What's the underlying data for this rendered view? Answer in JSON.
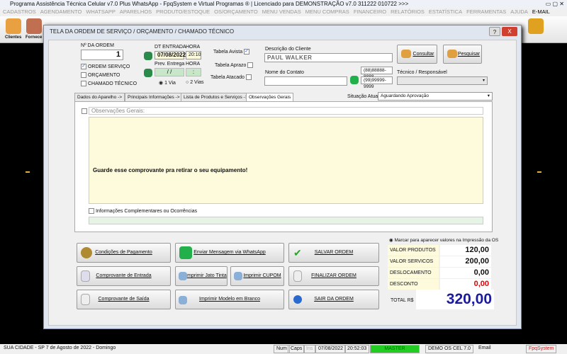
{
  "window": {
    "title": "Programa Assistência Técnica Celular v7.0 Plus WhatsApp - FpqSystem e Virtual Programas ® | Licenciado para  DEMONSTRAÇÃO v7.0 311222 010722 >>>"
  },
  "menu": [
    "CADASTROS",
    "AGENDAMENTO",
    "WHATSAPP",
    "APARELHOS",
    "PRODUTO/ESTOQUE",
    "OS/ORÇAMENTO",
    "MENU VENDAS",
    "MENU COMPRAS",
    "FINANCEIRO",
    "RELATÓRIOS",
    "ESTATÍSTICA",
    "FERRAMENTAS",
    "AJUDA",
    "E-MAIL"
  ],
  "toolbar": {
    "clientes": "Clientes",
    "fornece": "Fornece"
  },
  "dialog": {
    "title": "TELA DA ORDEM DE SERVIÇO / ORÇAMENTO / CHAMADO TÉCNICO",
    "help": "?",
    "close": "X"
  },
  "form": {
    "order_label": "Nº DA ORDEM",
    "order_value": "1",
    "types": [
      {
        "label": "ORDEM SERVIÇO",
        "checked": true
      },
      {
        "label": "ORÇAMENTO",
        "checked": false
      },
      {
        "label": "CHAMADO TÉCNICO",
        "checked": false
      }
    ],
    "dt_entrada_label": "DT ENTRADA",
    "hora_label": "HORA",
    "dt_entrada": "07/08/2022",
    "hora": "20:10",
    "prev_entrega_label": "Prev. Entrega",
    "hora2_label": "HORA",
    "prev_entrega": " / /",
    "hora2": ":",
    "via1": "1 Via",
    "via2": "2 Vias",
    "tables": [
      {
        "label": "Tabela Avista",
        "checked": true
      },
      {
        "label": "Tabela Aprazo",
        "checked": false
      },
      {
        "label": "Tabela Atacado",
        "checked": false
      }
    ],
    "cliente_label": "Descrição do Cliente",
    "cliente": "PAUL WALKER",
    "consultar": "Consultar",
    "pesquisar": "Pesquisar",
    "contato_label": "Nome do Contato",
    "contato": "",
    "phone1": "(88)88888-8888",
    "phone2": "(99)99999-9999",
    "tecnico_label": "Técnico / Responsável",
    "tecnico": ""
  },
  "tabs": [
    "Dados do Aparelho ->",
    "Principais Informações ->",
    "Lista de Produtos e Serviços ->",
    "Observações Gerais"
  ],
  "situacao_label": "Situação Atual:",
  "situacao": "Aguardando Aprovação",
  "obs": {
    "header": "Observações Gerais:",
    "text": "Guarde esse comprovante pra retirar o seu equipamento!",
    "complementares": "Informações Complementares ou Ocorrências"
  },
  "buttons": {
    "pagamento": "Condições de Pagamento",
    "whatsapp": "Enviar Mensagem via WhatsApp",
    "salvar": "SALVAR ORDEM",
    "entrada": "Comprovante de Entrada",
    "jato": "Imprimir Jato Tinta",
    "cupom": "Imprimir CUPOM",
    "finalizar": "FINALIZAR ORDEM",
    "saida": "Comprovante de Saída",
    "branco": "Imprimir Modelo em Branco",
    "sair": "SAIR DA ORDEM"
  },
  "values": {
    "marcar": "Marcar para aparecer valores na Impressão da OS",
    "rows": [
      {
        "label": "VALOR PRODUTOS",
        "value": "120,00"
      },
      {
        "label": "VALOR SERVICOS",
        "value": "200,00"
      },
      {
        "label": "DESLOCAMENTO",
        "value": "0,00"
      },
      {
        "label": "DESCONTO",
        "value": "0,00"
      }
    ],
    "total_label": "TOTAL R$",
    "total": "320,00"
  },
  "status": {
    "city": "SUA CIDADE - SP  7 de Agosto de 2022 - Domingo",
    "num": "Num",
    "caps": "Caps",
    "ins": "Ins",
    "date": "07/08/2022",
    "time": "20:52:03",
    "user": "MASTER",
    "version": "DEMO OS CEL 7.0",
    "email": "Email",
    "brand": "FpqSystem"
  },
  "colors": {
    "accent": "#1a1aa0",
    "red": "#e00000",
    "green": "#22cc22"
  }
}
